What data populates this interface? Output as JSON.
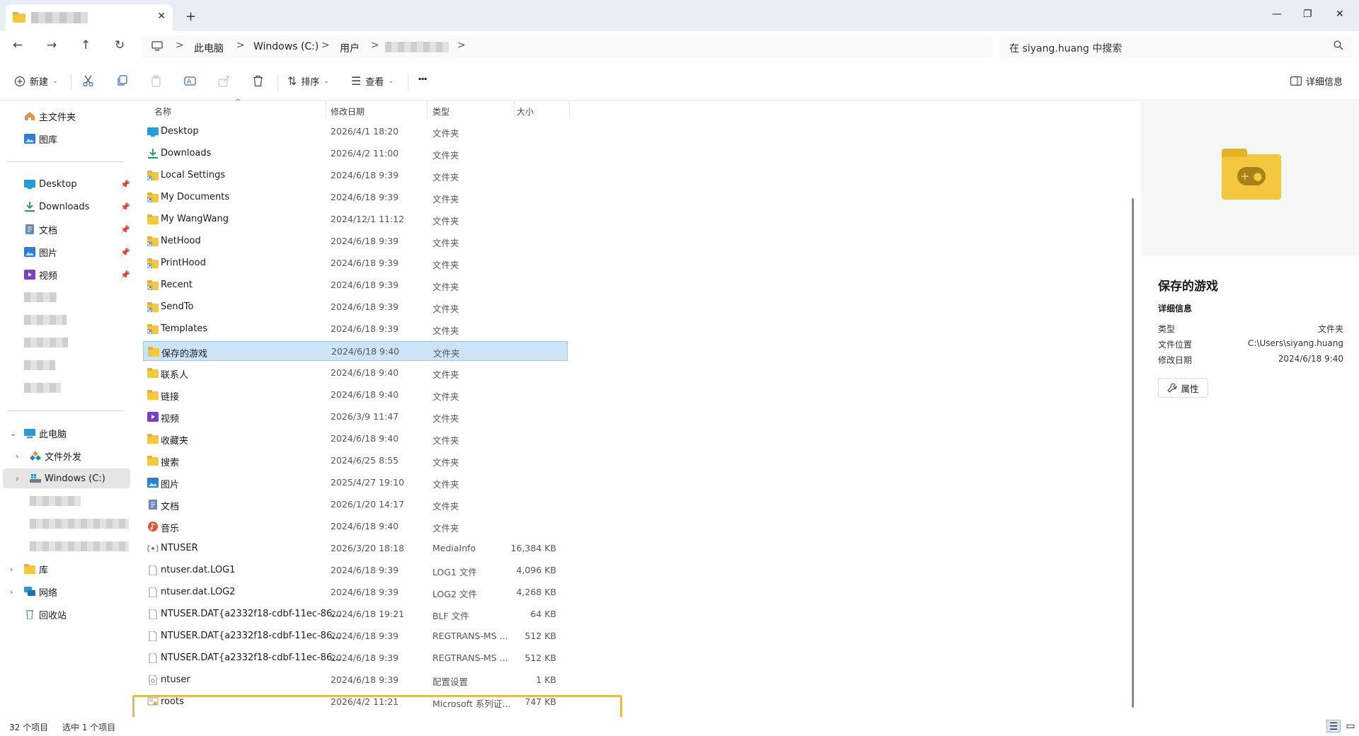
{
  "tabs": {
    "close_label": "✕",
    "new_label": "+"
  },
  "window": {
    "minimize": "—",
    "maximize": "❐",
    "close": "✕"
  },
  "nav": {
    "back": "←",
    "forward": "→",
    "up": "↑",
    "refresh": "↻"
  },
  "breadcrumb": {
    "items": [
      "此电脑",
      "Windows (C:)",
      "用户"
    ],
    "separator": ">"
  },
  "search": {
    "placeholder": "在 siyang.huang 中搜索"
  },
  "toolbar": {
    "new_label": "新建",
    "sort_label": "排序",
    "view_label": "查看",
    "more_label": "···",
    "details_label": "详细信息"
  },
  "sidebar": {
    "home": "主文件夹",
    "gallery": "图库",
    "quick": [
      {
        "label": "Desktop"
      },
      {
        "label": "Downloads"
      },
      {
        "label": "文档"
      },
      {
        "label": "图片"
      },
      {
        "label": "视频"
      }
    ],
    "this_pc": "此电脑",
    "file_share": "文件外发",
    "windows_c": "Windows (C:)",
    "library": "库",
    "network": "网络",
    "recycle": "回收站"
  },
  "columns": {
    "name": "名称",
    "date": "修改日期",
    "type": "类型",
    "size": "大小"
  },
  "files": [
    {
      "name": "Desktop",
      "date": "2026/4/1 18:20",
      "type": "文件夹",
      "size": "",
      "icon": "desktop-folder"
    },
    {
      "name": "Downloads",
      "date": "2026/4/2 11:00",
      "type": "文件夹",
      "size": "",
      "icon": "downloads-folder"
    },
    {
      "name": "Local Settings",
      "date": "2024/6/18 9:39",
      "type": "文件夹",
      "size": "",
      "icon": "shortcut-folder"
    },
    {
      "name": "My Documents",
      "date": "2024/6/18 9:39",
      "type": "文件夹",
      "size": "",
      "icon": "shortcut-folder"
    },
    {
      "name": "My WangWang",
      "date": "2024/12/1 11:12",
      "type": "文件夹",
      "size": "",
      "icon": "folder"
    },
    {
      "name": "NetHood",
      "date": "2024/6/18 9:39",
      "type": "文件夹",
      "size": "",
      "icon": "shortcut-folder"
    },
    {
      "name": "PrintHood",
      "date": "2024/6/18 9:39",
      "type": "文件夹",
      "size": "",
      "icon": "shortcut-folder"
    },
    {
      "name": "Recent",
      "date": "2024/6/18 9:39",
      "type": "文件夹",
      "size": "",
      "icon": "shortcut-folder"
    },
    {
      "name": "SendTo",
      "date": "2024/6/18 9:39",
      "type": "文件夹",
      "size": "",
      "icon": "shortcut-folder"
    },
    {
      "name": "Templates",
      "date": "2024/6/18 9:39",
      "type": "文件夹",
      "size": "",
      "icon": "shortcut-folder"
    },
    {
      "name": "保存的游戏",
      "date": "2024/6/18 9:40",
      "type": "文件夹",
      "size": "",
      "icon": "folder",
      "selected": true
    },
    {
      "name": "联系人",
      "date": "2024/6/18 9:40",
      "type": "文件夹",
      "size": "",
      "icon": "folder"
    },
    {
      "name": "链接",
      "date": "2024/6/18 9:40",
      "type": "文件夹",
      "size": "",
      "icon": "folder"
    },
    {
      "name": "视频",
      "date": "2026/3/9 11:47",
      "type": "文件夹",
      "size": "",
      "icon": "video-folder"
    },
    {
      "name": "收藏夹",
      "date": "2024/6/18 9:40",
      "type": "文件夹",
      "size": "",
      "icon": "folder"
    },
    {
      "name": "搜索",
      "date": "2024/6/25 8:55",
      "type": "文件夹",
      "size": "",
      "icon": "folder"
    },
    {
      "name": "图片",
      "date": "2025/4/27 19:10",
      "type": "文件夹",
      "size": "",
      "icon": "pictures-folder"
    },
    {
      "name": "文档",
      "date": "2026/1/20 14:17",
      "type": "文件夹",
      "size": "",
      "icon": "documents-folder"
    },
    {
      "name": "音乐",
      "date": "2024/6/18 9:40",
      "type": "文件夹",
      "size": "",
      "icon": "music-folder"
    },
    {
      "name": "NTUSER",
      "date": "2026/3/20 18:18",
      "type": "MediaInfo",
      "size": "16,384 KB",
      "icon": "mediainfo-file"
    },
    {
      "name": "ntuser.dat.LOG1",
      "date": "2024/6/18 9:39",
      "type": "LOG1 文件",
      "size": "4,096 KB",
      "icon": "file"
    },
    {
      "name": "ntuser.dat.LOG2",
      "date": "2024/6/18 9:39",
      "type": "LOG2 文件",
      "size": "4,268 KB",
      "icon": "file"
    },
    {
      "name": "NTUSER.DAT{a2332f18-cdbf-11ec-86...",
      "date": "2024/6/18 19:21",
      "type": "BLF 文件",
      "size": "64 KB",
      "icon": "file"
    },
    {
      "name": "NTUSER.DAT{a2332f18-cdbf-11ec-86...",
      "date": "2024/6/18 9:39",
      "type": "REGTRANS-MS ...",
      "size": "512 KB",
      "icon": "file"
    },
    {
      "name": "NTUSER.DAT{a2332f18-cdbf-11ec-86...",
      "date": "2024/6/18 9:39",
      "type": "REGTRANS-MS ...",
      "size": "512 KB",
      "icon": "file"
    },
    {
      "name": "ntuser",
      "date": "2024/6/18 9:39",
      "type": "配置设置",
      "size": "1 KB",
      "icon": "settings-file"
    },
    {
      "name": "roots",
      "date": "2026/4/2 11:21",
      "type": "Microsoft 系列证...",
      "size": "747 KB",
      "icon": "certificate-file"
    }
  ],
  "details": {
    "title": "保存的游戏",
    "section": "详细信息",
    "rows": [
      {
        "key": "类型",
        "value": "文件夹"
      },
      {
        "key": "文件位置",
        "value": "C:\\Users\\siyang.huang"
      },
      {
        "key": "修改日期",
        "value": "2024/6/18 9:40"
      }
    ],
    "properties_label": "属性"
  },
  "status": {
    "count": "32 个项目",
    "selected": "选中 1 个项目"
  }
}
